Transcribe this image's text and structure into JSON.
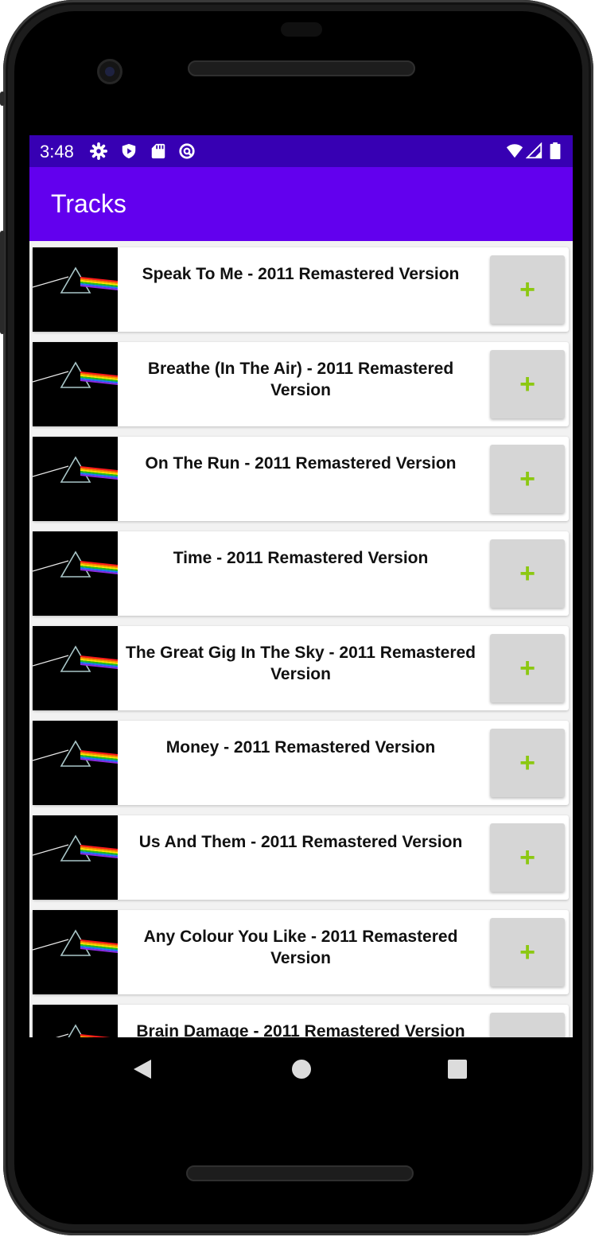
{
  "status_bar": {
    "time": "3:48",
    "left_icons": [
      "gear-icon",
      "shield-icon",
      "sd-card-icon",
      "at-sign-icon"
    ],
    "right_icons": [
      "wifi-icon",
      "signal-icon",
      "battery-icon"
    ]
  },
  "app_bar": {
    "title": "Tracks"
  },
  "tracks": [
    {
      "title": "Speak To Me - 2011 Remastered Version",
      "button": "+"
    },
    {
      "title": "Breathe (In The Air) - 2011 Remastered Version",
      "button": "+"
    },
    {
      "title": "On The Run - 2011 Remastered Version",
      "button": "+"
    },
    {
      "title": "Time - 2011 Remastered Version",
      "button": "+"
    },
    {
      "title": "The Great Gig In The Sky - 2011 Remastered Version",
      "button": "+"
    },
    {
      "title": "Money - 2011 Remastered Version",
      "button": "+"
    },
    {
      "title": "Us And Them - 2011 Remastered Version",
      "button": "+"
    },
    {
      "title": "Any Colour You Like - 2011 Remastered Version",
      "button": "+"
    },
    {
      "title": "Brain Damage - 2011 Remastered Version",
      "button": "+"
    }
  ],
  "nav_bar": {
    "buttons": [
      "back-icon",
      "home-icon",
      "recents-icon"
    ]
  },
  "colors": {
    "status_bar": "#3700b3",
    "app_bar": "#6200ee",
    "add_button_bg": "#d6d6d6",
    "add_button_plus": "#8cc811"
  }
}
